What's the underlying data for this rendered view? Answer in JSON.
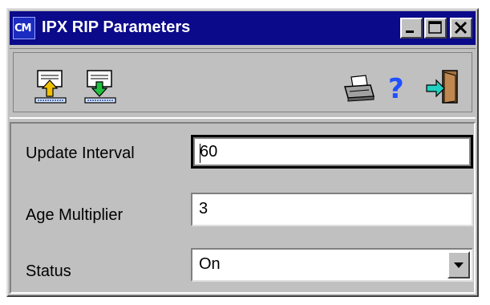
{
  "window": {
    "title": "IPX RIP Parameters",
    "app_icon_text": "CM",
    "title_bar_color": "#0a0a8a"
  },
  "titlebar_buttons": [
    "minimize-icon",
    "maximize-icon",
    "close-icon"
  ],
  "toolbar": {
    "icons": [
      "upload-icon",
      "download-icon",
      "printer-icon",
      "help-icon",
      "exit-icon"
    ],
    "help_glyph": "?"
  },
  "form": {
    "update_interval": {
      "label": "Update Interval",
      "value": "60"
    },
    "age_multiplier": {
      "label": "Age Multiplier",
      "value": "3"
    },
    "status": {
      "label": "Status",
      "value": "On"
    }
  }
}
